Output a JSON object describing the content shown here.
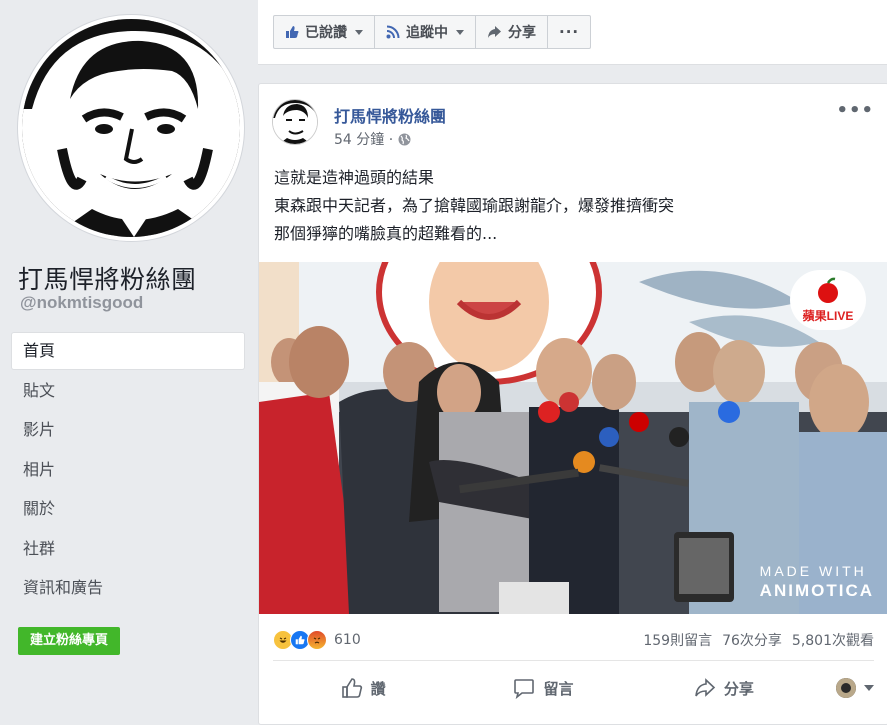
{
  "sidebar": {
    "page_name": "打馬悍將粉絲團",
    "handle": "@nokmtisgood",
    "nav": [
      "首頁",
      "貼文",
      "影片",
      "相片",
      "關於",
      "社群",
      "資訊和廣告"
    ],
    "create_page": "建立粉絲專頁"
  },
  "topbar": {
    "liked": "已說讚",
    "following": "追蹤中",
    "share": "分享",
    "more": "···"
  },
  "post": {
    "author": "打馬悍將粉絲團",
    "time": "54 分鐘 ·",
    "lines": [
      "這就是造神過頭的結果",
      "東森跟中天記者，為了搶韓國瑜跟謝龍介，爆發推擠衝突",
      "那個猙獰的嘴臉真的超難看的..."
    ],
    "video_watermark_1": "MADE WITH",
    "video_watermark_2": "ANIMOTICA",
    "badge": "蘋果LIVE",
    "reaction_count": "610",
    "comments": "159則留言",
    "shares": "76次分享",
    "views": "5,801次觀看",
    "like_action": "讚",
    "comment_action": "留言",
    "share_action": "分享"
  },
  "colors": {
    "link": "#365899",
    "green": "#42b72a",
    "background": "#e9ebee"
  }
}
